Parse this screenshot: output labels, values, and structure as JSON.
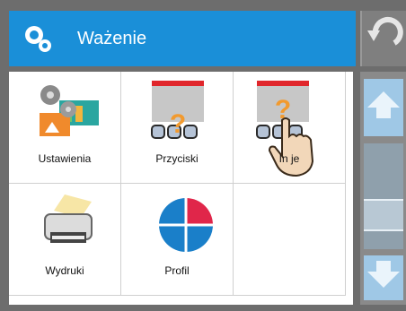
{
  "header": {
    "title": "Ważenie",
    "icon": "settings-gears-icon"
  },
  "tiles": [
    {
      "label": "Ustawienia",
      "icon": "settings-icon"
    },
    {
      "label": "Przyciski",
      "icon": "keys-help-icon"
    },
    {
      "label": "Informacje",
      "label_visible": "In      je",
      "icon": "info-help-icon"
    },
    {
      "label": "Wydruki",
      "icon": "printer-icon"
    },
    {
      "label": "Profil",
      "icon": "profile-pie-icon"
    }
  ],
  "colors": {
    "header": "#1a8fd8",
    "scroll": "#9fc8e6",
    "red": "#e0262b",
    "orange": "#f29a2e"
  }
}
